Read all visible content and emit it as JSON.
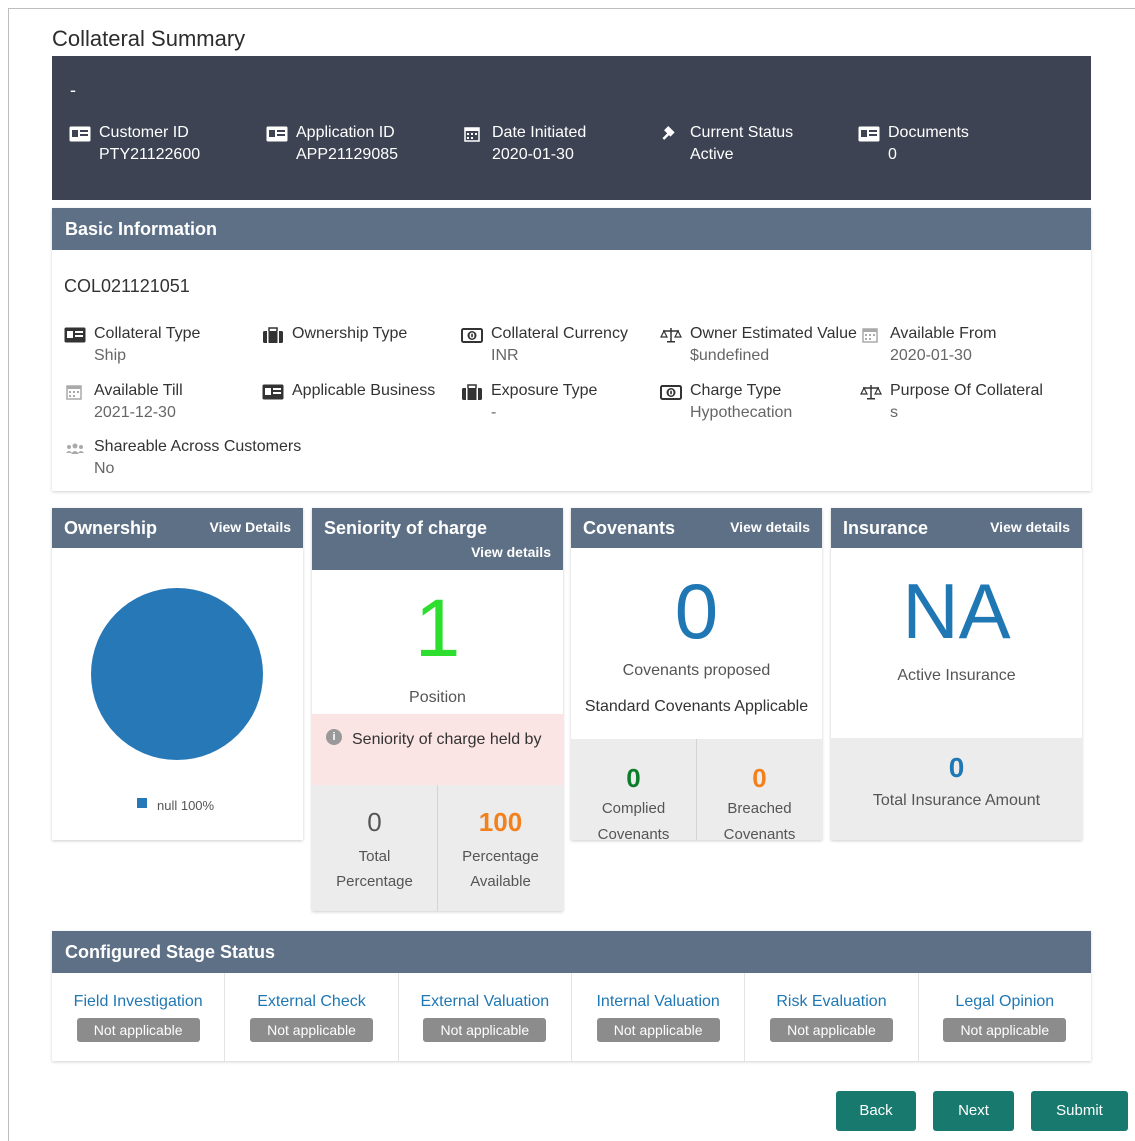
{
  "page_title": "Collateral Summary",
  "hero": {
    "dash": "-",
    "items": [
      {
        "label": "Customer ID",
        "value": "PTY21122600",
        "icon": "id-card-icon"
      },
      {
        "label": "Application ID",
        "value": "APP21129085",
        "icon": "id-card-icon"
      },
      {
        "label": "Date Initiated",
        "value": "2020-01-30",
        "icon": "calendar-icon"
      },
      {
        "label": "Current Status",
        "value": "Active",
        "icon": "gavel-icon"
      },
      {
        "label": "Documents",
        "value": "0",
        "icon": "id-card-icon"
      }
    ]
  },
  "basic": {
    "title": "Basic Information",
    "collateral_id": "COL021121051",
    "fields": [
      {
        "label": "Collateral Type",
        "value": "Ship",
        "icon": "id-card-icon"
      },
      {
        "label": "Ownership Type",
        "value": "",
        "icon": "briefcase-icon"
      },
      {
        "label": "Collateral Currency",
        "value": "INR",
        "icon": "money-icon"
      },
      {
        "label": "Owner Estimated Value",
        "value": "$undefined",
        "icon": "scale-icon"
      },
      {
        "label": "Available From",
        "value": "2020-01-30",
        "icon": "calendar-icon"
      },
      {
        "label": "Available Till",
        "value": "2021-12-30",
        "icon": "calendar-icon"
      },
      {
        "label": "Applicable Business",
        "value": "",
        "icon": "id-card-icon"
      },
      {
        "label": "Exposure Type",
        "value": "-",
        "icon": "briefcase-icon"
      },
      {
        "label": "Charge Type",
        "value": "Hypothecation",
        "icon": "money-icon"
      },
      {
        "label": "Purpose Of Collateral",
        "value": "s",
        "icon": "scale-icon"
      },
      {
        "label": "Shareable Across Customers",
        "value": "No",
        "icon": "users-icon"
      }
    ]
  },
  "ownership": {
    "title": "Ownership",
    "link": "View Details",
    "legend": "null 100%",
    "chart_color": "#2678b6",
    "share": 100
  },
  "seniority": {
    "title": "Seniority of charge",
    "link": "View details",
    "position_value": "1",
    "position_label": "Position",
    "notice": "Seniority of charge held by",
    "total_value": "0",
    "total_label": "Total Percentage",
    "available_value": "100",
    "available_label": "Percentage Available"
  },
  "covenants": {
    "title": "Covenants",
    "link": "View details",
    "count": "0",
    "proposed_label": "Covenants proposed",
    "standard_label": "Standard Covenants Applicable",
    "complied_value": "0",
    "complied_label": "Complied Covenants",
    "breached_value": "0",
    "breached_label": "Breached Covenants"
  },
  "insurance": {
    "title": "Insurance",
    "link": "View details",
    "value": "NA",
    "active_label": "Active Insurance",
    "amount_value": "0",
    "amount_label": "Total Insurance Amount"
  },
  "stage": {
    "title": "Configured Stage Status",
    "stages": [
      {
        "name": "Field Investigation",
        "status": "Not applicable"
      },
      {
        "name": "External Check",
        "status": "Not applicable"
      },
      {
        "name": "External Valuation",
        "status": "Not applicable"
      },
      {
        "name": "Internal Valuation",
        "status": "Not applicable"
      },
      {
        "name": "Risk Evaluation",
        "status": "Not applicable"
      },
      {
        "name": "Legal Opinion",
        "status": "Not applicable"
      }
    ]
  },
  "buttons": {
    "back": "Back",
    "next": "Next",
    "submit": "Submit"
  },
  "colors": {
    "header_bg": "#3d4352",
    "section_head": "#5e7085",
    "accent_green": "#2ede2e",
    "accent_blue": "#1f77b4",
    "accent_orange": "#f2811d",
    "dark_green": "#0d7d2b",
    "button": "#187a6e"
  }
}
